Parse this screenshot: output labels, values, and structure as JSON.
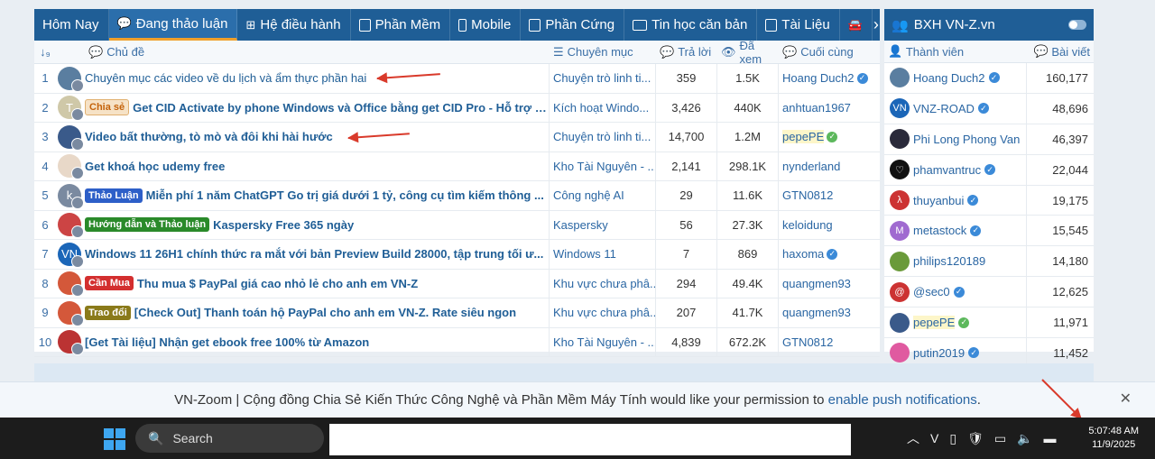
{
  "tabs": [
    {
      "label": "Hôm Nay",
      "icon": "none"
    },
    {
      "label": "Đang thảo luận",
      "icon": "chat-icon"
    },
    {
      "label": "Hệ điều hành",
      "icon": "windows-icon"
    },
    {
      "label": "Phần Mềm",
      "icon": "window-icon"
    },
    {
      "label": "Mobile",
      "icon": "mobile-icon"
    },
    {
      "label": "Phần Cứng",
      "icon": "chip-icon"
    },
    {
      "label": "Tin học căn bản",
      "icon": "monitor-icon"
    },
    {
      "label": "Tài Liệu",
      "icon": "book-icon"
    }
  ],
  "table_headers": {
    "num": "↓₉",
    "title": "Chủ đề",
    "forum": "Chuyên mục",
    "replies": "Trả lời",
    "views": "Đã xem",
    "last": "Cuối cùng"
  },
  "threads": [
    {
      "num": "1",
      "tag": "",
      "title": "Chuyên mục các video về du lịch và ẩm thực phần hai",
      "forum": "Chuyện trò linh ti...",
      "replies": "359",
      "views": "1.5K",
      "last": "Hoang Duch2"
    },
    {
      "num": "2",
      "tag": "Chia sẻ",
      "title": "Get CID Activate by phone Windows và Office bằng get CID Pro - Hỗ trợ c...",
      "forum": "Kích hoạt Windo...",
      "replies": "3,426",
      "views": "440K",
      "last": "anhtuan1967"
    },
    {
      "num": "3",
      "tag": "",
      "title": "Video bất thường, tò mò và đôi khi hài hước",
      "forum": "Chuyện trò linh ti...",
      "replies": "14,700",
      "views": "1.2M",
      "last": "pepePE"
    },
    {
      "num": "4",
      "tag": "",
      "title": "Get khoá học udemy free",
      "forum": "Kho Tài Nguyên - ...",
      "replies": "2,141",
      "views": "298.1K",
      "last": "nynderland"
    },
    {
      "num": "5",
      "tag": "Thảo Luận",
      "title": "Miễn phí 1 năm ChatGPT Go trị giá dưới 1 tỷ, công cụ tìm kiếm thông ...",
      "forum": "Công nghệ AI",
      "replies": "29",
      "views": "11.6K",
      "last": "GTN0812"
    },
    {
      "num": "6",
      "tag": "Hướng dẫn và Thảo luận",
      "title": "Kaspersky Free 365 ngày",
      "forum": "Kaspersky",
      "replies": "56",
      "views": "27.3K",
      "last": "keloidung"
    },
    {
      "num": "7",
      "tag": "",
      "title": "Windows 11 26H1 chính thức ra mắt với bản Preview Build 28000, tập trung tối ư...",
      "forum": "Windows 11",
      "replies": "7",
      "views": "869",
      "last": "haxoma"
    },
    {
      "num": "8",
      "tag": "Cần Mua",
      "title": "Thu mua $ PayPal giá cao nhỏ lẻ cho anh em VN-Z",
      "forum": "Khu vực chưa phâ...",
      "replies": "294",
      "views": "49.4K",
      "last": "quangmen93"
    },
    {
      "num": "9",
      "tag": "Trao đổi",
      "title": "[Check Out] Thanh toán hộ PayPal cho anh em VN-Z. Rate siêu ngon",
      "forum": "Khu vực chưa phâ...",
      "replies": "207",
      "views": "41.7K",
      "last": "quangmen93"
    },
    {
      "num": "10",
      "tag": "",
      "title": "[Get Tài liệu] Nhận get ebook free 100% từ Amazon",
      "forum": "Kho Tài Nguyên - ...",
      "replies": "4,839",
      "views": "672.2K",
      "last": "GTN0812"
    }
  ],
  "tag_colors": {
    "Chia sẻ": "#f6e2c6",
    "Thảo Luận": "#2d5fc8",
    "Hướng dẫn và Thảo luận": "#2a8a2a",
    "Cần Mua": "#d32f2f",
    "Trao đổi": "#8a7a1a"
  },
  "avatar_letters": [
    "",
    "T",
    "",
    "",
    "k",
    "",
    "VN",
    "",
    "",
    ""
  ],
  "sidebar": {
    "title": "BXH VN-Z.vn",
    "col_member": "Thành viên",
    "col_posts": "Bài viết",
    "members": [
      {
        "name": "Hoang Duch2",
        "posts": "160,177"
      },
      {
        "name": "VNZ-ROAD",
        "posts": "48,696"
      },
      {
        "name": "Phi Long Phong Van",
        "posts": "46,397"
      },
      {
        "name": "phamvantruc",
        "posts": "22,044"
      },
      {
        "name": "thuyanbui",
        "posts": "19,175"
      },
      {
        "name": "metastock",
        "posts": "15,545"
      },
      {
        "name": "philips120189",
        "posts": "14,180"
      },
      {
        "name": "@sec0",
        "posts": "12,625"
      },
      {
        "name": "pepePE",
        "posts": "11,971"
      },
      {
        "name": "putin2019",
        "posts": "11,452"
      }
    ]
  },
  "notification": {
    "text": "VN-Zoom | Cộng đồng Chia Sẻ Kiến Thức Công Nghệ và Phần Mềm Máy Tính would like your permission to ",
    "link": "enable push notifications",
    "suffix": "."
  },
  "taskbar": {
    "search_placeholder": "Search",
    "time": "5:07:48 AM",
    "date": "11/9/2025"
  }
}
